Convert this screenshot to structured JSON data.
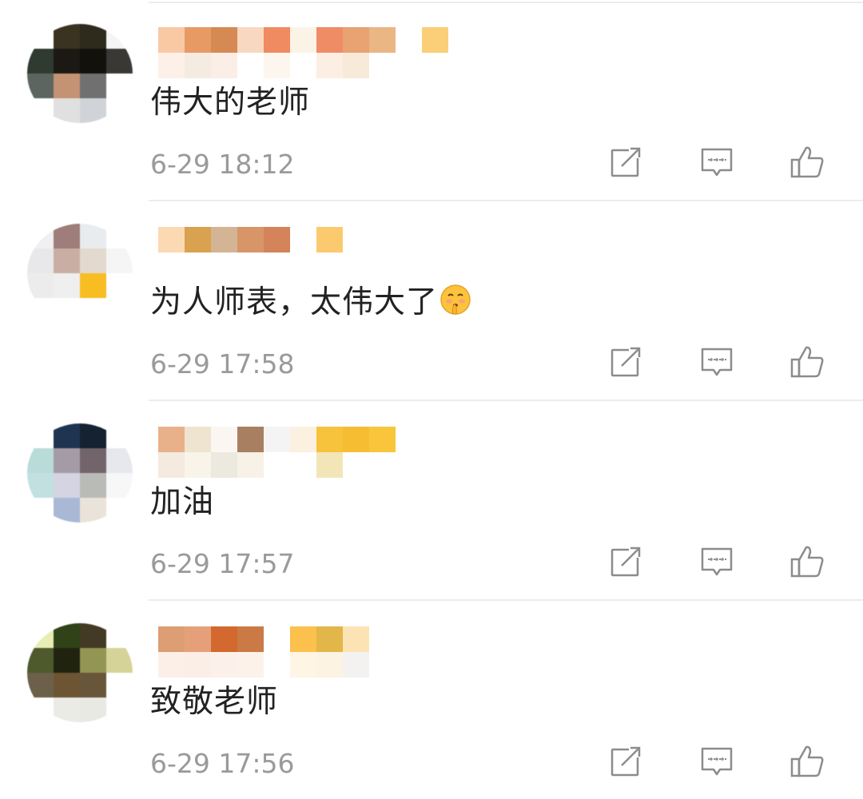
{
  "colors": {
    "text_primary": "#222222",
    "text_secondary": "#9a9a9a",
    "divider": "#ececec",
    "icon": "#8c8c8c"
  },
  "icons": {
    "share": "share-icon",
    "reply": "reply-icon",
    "like": "like-icon"
  },
  "comments": [
    {
      "text": "伟大的老师",
      "emoji": "",
      "time": "6-29 18:12",
      "avatar_pixels": [
        "#ffffff",
        "#3a3320",
        "#2e2a1c",
        "#f5f5f5",
        "#2f3a30",
        "#1c1814",
        "#12110c",
        "#3a3834",
        "#5d6560",
        "#c49373",
        "#707070",
        "#ffffff",
        "#ffffff",
        "#e0e0e0",
        "#d0d4d8",
        "#ffffff"
      ],
      "name_pixels": [
        "#f9c9a4",
        "#e89a64",
        "#d68a53",
        "#f8d8c0",
        "#f08a60",
        "#fbf3e6",
        "#ef8c66",
        "#e9a272",
        "#e9b684",
        "#ffffff",
        "#fbcf78",
        "#fdf0e8",
        "#f4ece0",
        "#fbeee6",
        "#ffffff",
        "#fdf6ee",
        "#ffffff",
        "#fdeee4",
        "#f7ead9",
        "#ffffff",
        "#ffffff",
        "#ffffff"
      ]
    },
    {
      "text": "为人师表，太伟大了",
      "emoji": "shushing-face-emoji",
      "time": "6-29 17:58",
      "avatar_pixels": [
        "#f0f0f0",
        "#9e7d7a",
        "#e9ecef",
        "#ffffff",
        "#e8e8ea",
        "#c9aea3",
        "#e3d9cf",
        "#f5f5f5",
        "#ececec",
        "#efefef",
        "#f7bd22",
        "#ffffff",
        "#ffffff",
        "#ffffff",
        "#ffffff",
        "#ffffff"
      ],
      "name_pixels": [
        "#fbd9b2",
        "#d9a250",
        "#d3b495",
        "#d79568",
        "#d4835a",
        "#ffffff",
        "#fcca6e",
        "#ffffff",
        "#ffffff",
        "#ffffff",
        "#ffffff",
        "#ffffff",
        "#ffffff",
        "#ffffff",
        "#ffffff",
        "#ffffff",
        "#ffffff",
        "#ffffff",
        "#ffffff",
        "#ffffff",
        "#ffffff",
        "#ffffff"
      ]
    },
    {
      "text": "加油",
      "emoji": "",
      "time": "6-29 17:57",
      "avatar_pixels": [
        "#ffffff",
        "#1f3450",
        "#152232",
        "#ffffff",
        "#b9dbd9",
        "#a59ba7",
        "#72646a",
        "#e6e8ee",
        "#c2e0df",
        "#d4d4e2",
        "#b9bbb6",
        "#f7f7f7",
        "#ffffff",
        "#a9b8d5",
        "#eae3d9",
        "#ffffff"
      ],
      "name_pixels": [
        "#e9b18a",
        "#efe4d0",
        "#fbf6f2",
        "#a88061",
        "#f4f4f4",
        "#fcf0e0",
        "#f7c23c",
        "#f7bd32",
        "#f9c53a",
        "#ffffff",
        "#ffffff",
        "#f4eadf",
        "#f9f4ea",
        "#ece9df",
        "#f7f1e7",
        "#ffffff",
        "#ffffff",
        "#f2e6b8",
        "#ffffff",
        "#ffffff",
        "#ffffff",
        "#ffffff"
      ]
    },
    {
      "text": "致敬老师",
      "emoji": "",
      "time": "6-29 17:56",
      "avatar_pixels": [
        "#e8edb4",
        "#2f4218",
        "#423a25",
        "#ffffff",
        "#4e5a2c",
        "#1f2310",
        "#939553",
        "#d6d398",
        "#6c604a",
        "#6d5534",
        "#69553a",
        "#ffffff",
        "#ffffff",
        "#ebebe6",
        "#e9e9e4",
        "#ffffff"
      ],
      "name_pixels": [
        "#dc9e72",
        "#e5a07a",
        "#d3692e",
        "#cb7a45",
        "#ffffff",
        "#fcc04c",
        "#e2b648",
        "#fbe3b4",
        "#ffffff",
        "#ffffff",
        "#ffffff",
        "#fbefe8",
        "#fbeee6",
        "#fcf1ea",
        "#fcf2ea",
        "#ffffff",
        "#fef5e4",
        "#fdf3e3",
        "#f4f2f0",
        "#ffffff",
        "#ffffff",
        "#ffffff"
      ]
    }
  ]
}
